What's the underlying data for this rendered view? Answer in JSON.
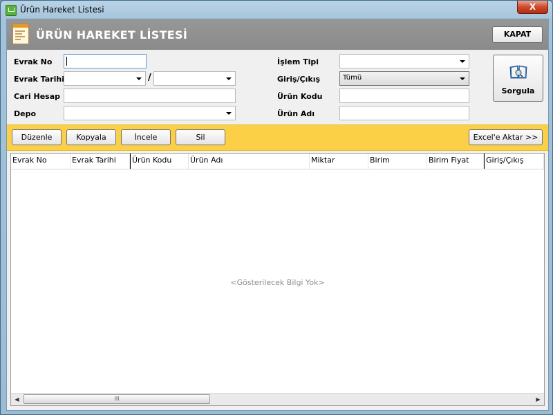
{
  "window": {
    "title": "Ürün Hareket Listesi",
    "close_label": "X"
  },
  "header": {
    "title": "ÜRÜN HAREKET LİSTESİ",
    "close_button": "KAPAT"
  },
  "filters": {
    "evrak_no_label": "Evrak No",
    "evrak_tarihi_label": "Evrak Tarihi",
    "date_separator": "/",
    "cari_hesap_label": "Cari Hesap",
    "depo_label": "Depo",
    "islem_tipi_label": "İşlem Tipi",
    "giris_cikis_label": "Giriş/Çıkış",
    "giris_cikis_value": "Tümü",
    "urun_kodu_label": "Ürün Kodu",
    "urun_adi_label": "Ürün Adı",
    "query_button": "Sorgula"
  },
  "toolbar": {
    "edit": "Düzenle",
    "copy": "Kopyala",
    "inspect": "İncele",
    "delete": "Sil",
    "export": "Excel'e Aktar >>"
  },
  "grid": {
    "columns": [
      "Evrak No",
      "Evrak Tarihi",
      "Ürün Kodu",
      "Ürün Adı",
      "Miktar",
      "Birim",
      "Birim Fiyat",
      "Giriş/Çıkış"
    ],
    "empty_text": "<Gösterilecek Bilgi Yok>",
    "scroll_left": "◀",
    "scroll_right": "▶",
    "thumb_grip": "III"
  }
}
